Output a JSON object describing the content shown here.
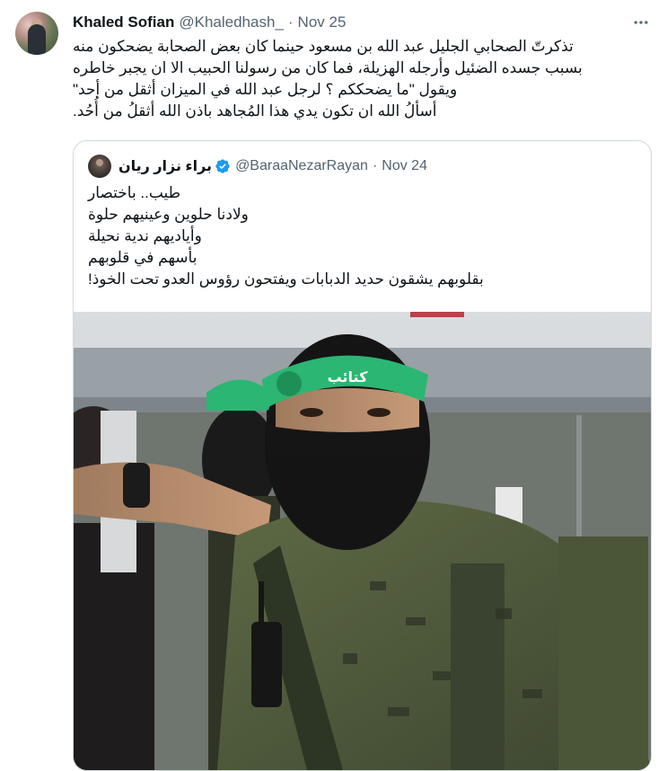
{
  "tweet": {
    "author": {
      "name": "Khaled Sofian",
      "handle": "@Khaledhash_",
      "separator": "·",
      "date": "Nov 25"
    },
    "more_icon": "more-horizontal-icon",
    "text_lines": [
      "تذكرتّ الصحابي الجليل عبد الله بن مسعود حينما كان  بعض الصحابة يضحكون منه",
      "بسبب جسده الضئيل وأرجله الهزيلة، فما كان من رسولنا الحبيب الا ان يجبر خاطره",
      "ويقول \"ما يضحككم ؟ لرجل عبد الله في الميزان أثقل من أحد\"",
      "أسألُ الله ان تكون يدي هذا المُجاهد باذن الله أثقلُ من أُحُد."
    ]
  },
  "quote": {
    "author": {
      "name": "براء نزار ريان",
      "handle": "@BaraaNezarRayan",
      "separator": "·",
      "date": "Nov 24",
      "verified_icon": "verified-badge-icon"
    },
    "text_lines": [
      "طيب.. باختصار",
      "ولادنا حلوين وعينيهم حلوة",
      "وأياديهم ندية نحيلة",
      "بأسهم في قلوبهم",
      "بقلوبهم يشقون حديد الدبابات ويفتحون رؤوس العدو تحت الخوذ!"
    ],
    "media": {
      "headband_text": "كتائب"
    }
  },
  "colors": {
    "text_primary": "#0f1419",
    "text_secondary": "#536471",
    "border": "#cfd9de",
    "verified": "#1d9bf0",
    "headband": "#2bb673"
  }
}
